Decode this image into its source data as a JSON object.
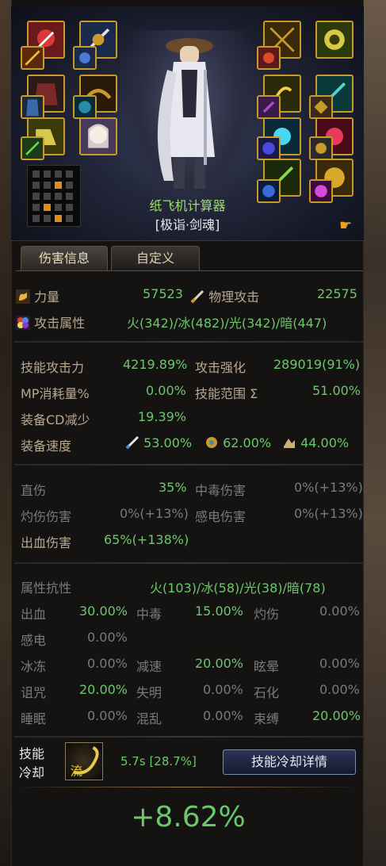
{
  "hero": {
    "name": "纸飞机计算器",
    "title": "[极诣·剑魂]",
    "hand_icon": "pointing-hand-icon"
  },
  "tabs": [
    {
      "label": "伤害信息"
    },
    {
      "label": "自定义"
    }
  ],
  "stats1": {
    "str_label": "力量",
    "str_val": "57523",
    "atk_label": "物理攻击",
    "atk_val": "22575",
    "elem_label": "攻击属性",
    "elem_val": "火(342)/冰(482)/光(342)/暗(447)"
  },
  "stats2": {
    "skill_atk_label": "技能攻击力",
    "skill_atk_val": "4219.89%",
    "atk_enh_label": "攻击强化",
    "atk_enh_val": "289019(91%)",
    "mp_label": "MP消耗量%",
    "mp_val": "0.00%",
    "range_label": "技能范围 Σ",
    "range_val": "51.00%",
    "cd_label": "装备CD减少",
    "cd_val": "19.39%",
    "speed_label": "装备速度",
    "atk_speed": "53.00%",
    "cast_speed": "62.00%",
    "move_speed": "44.00%"
  },
  "stats3": {
    "direct_label": "直伤",
    "direct_val": "35%",
    "poison_label": "中毒伤害",
    "poison_val": "0%(+13%)",
    "burn_label": "灼伤伤害",
    "burn_val": "0%(+13%)",
    "shock_label": "感电伤害",
    "shock_val": "0%(+13%)",
    "bleed_label": "出血伤害",
    "bleed_val": "65%(+138%)"
  },
  "stats4": {
    "res_label": "属性抗性",
    "res_val": "火(103)/冰(58)/光(38)/暗(78)",
    "bleed_label": "出血",
    "bleed_val": "30.00%",
    "poison_label": "中毒",
    "poison_val": "15.00%",
    "burn_label": "灼伤",
    "burn_val": "0.00%",
    "shock_label": "感电",
    "shock_val": "0.00%",
    "freeze_label": "冰冻",
    "freeze_val": "0.00%",
    "slow_label": "减速",
    "slow_val": "20.00%",
    "stun_label": "眩晕",
    "stun_val": "0.00%",
    "curse_label": "诅咒",
    "curse_val": "20.00%",
    "blind_label": "失明",
    "blind_val": "0.00%",
    "stone_label": "石化",
    "stone_val": "0.00%",
    "sleep_label": "睡眠",
    "sleep_val": "0.00%",
    "chaos_label": "混乱",
    "chaos_val": "0.00%",
    "bind_label": "束缚",
    "bind_val": "20.00%"
  },
  "cooldown": {
    "label1": "技能",
    "label2": "冷却",
    "icon_text": "流",
    "value": "5.7s [28.7%]",
    "button": "技能冷却详情"
  },
  "result": {
    "value": "+8.62%"
  }
}
